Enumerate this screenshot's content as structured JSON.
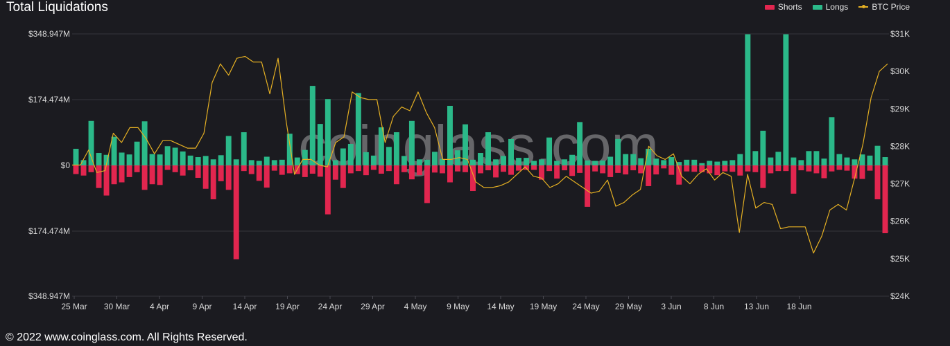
{
  "header": {
    "title": "Total Liquidations"
  },
  "legend": [
    {
      "label": "Shorts",
      "color": "#e2264f",
      "kind": "bar"
    },
    {
      "label": "Longs",
      "color": "#2bb989",
      "kind": "bar"
    },
    {
      "label": "BTC Price",
      "color": "#e5b023",
      "kind": "line"
    }
  ],
  "watermark": "coinglass.com",
  "footer": {
    "copyright": "© 2022 www.coinglass.com. All Rights Reserved."
  },
  "chart_data": {
    "type": "bar",
    "title": "Total Liquidations",
    "x_tick_labels": [
      "25 Mar",
      "30 Mar",
      "4 Apr",
      "9 Apr",
      "14 Apr",
      "19 Apr",
      "24 Apr",
      "29 Apr",
      "4 May",
      "9 May",
      "14 May",
      "19 May",
      "24 May",
      "29 May",
      "3 Jun",
      "8 Jun",
      "13 Jun",
      "18 Jun"
    ],
    "y_left_ticks": [
      "$348.947M",
      "$174.474M",
      "$0",
      "$174.474M",
      "$348.947M"
    ],
    "y_left_range": [
      -348.947,
      348.947
    ],
    "y_right_ticks": [
      "$31K",
      "$30K",
      "$29K",
      "$28K",
      "$27K",
      "$26K",
      "$25K",
      "$24K"
    ],
    "y_right_range": [
      24000,
      31000
    ],
    "units_left": "$M",
    "series": [
      {
        "name": "Longs",
        "color": "#2bb989",
        "values": [
          44,
          14,
          118,
          33,
          28,
          76,
          34,
          29,
          63,
          117,
          30,
          29,
          51,
          47,
          37,
          26,
          22,
          25,
          16,
          27,
          78,
          16,
          88,
          14,
          12,
          23,
          14,
          15,
          84,
          21,
          41,
          211,
          110,
          176,
          14,
          45,
          57,
          192,
          35,
          26,
          101,
          49,
          88,
          25,
          118,
          16,
          15,
          36,
          17,
          158,
          40,
          109,
          15,
          33,
          88,
          16,
          25,
          70,
          20,
          20,
          12,
          16,
          74,
          12,
          16,
          28,
          115,
          13,
          12,
          13,
          23,
          70,
          30,
          30,
          19,
          44,
          18,
          14,
          22,
          9,
          15,
          15,
          6,
          12,
          10,
          12,
          14,
          30,
          348,
          38,
          92,
          21,
          36,
          348,
          21,
          14,
          38,
          38,
          18,
          128,
          30,
          21,
          16,
          29,
          26,
          52,
          22
        ]
      },
      {
        "name": "Shorts",
        "color": "#e2264f",
        "values": [
          23,
          27,
          18,
          60,
          80,
          50,
          45,
          31,
          18,
          65,
          50,
          52,
          12,
          18,
          27,
          13,
          33,
          62,
          90,
          42,
          65,
          249,
          15,
          23,
          41,
          59,
          14,
          25,
          21,
          23,
          31,
          22,
          30,
          130,
          38,
          60,
          21,
          15,
          26,
          12,
          22,
          15,
          50,
          18,
          37,
          26,
          100,
          19,
          21,
          45,
          16,
          18,
          68,
          21,
          13,
          32,
          17,
          25,
          14,
          12,
          12,
          38,
          15,
          35,
          13,
          28,
          20,
          110,
          16,
          21,
          31,
          20,
          24,
          13,
          21,
          55,
          24,
          8,
          25,
          51,
          16,
          17,
          18,
          21,
          26,
          16,
          17,
          27,
          16,
          18,
          60,
          21,
          15,
          15,
          75,
          13,
          16,
          21,
          34,
          16,
          12,
          14,
          35,
          36,
          14,
          90,
          180
        ]
      },
      {
        "name": "BTC Price",
        "color": "#e5b023",
        "values": [
          27500,
          27500,
          27900,
          27300,
          27350,
          28350,
          28100,
          28500,
          28500,
          28200,
          27800,
          28150,
          28150,
          28050,
          27950,
          27950,
          28350,
          29700,
          30200,
          29900,
          30350,
          30400,
          30250,
          30250,
          29400,
          30350,
          28650,
          27250,
          27650,
          27650,
          27500,
          27450,
          28100,
          28250,
          29450,
          29300,
          29250,
          29250,
          28100,
          28800,
          29050,
          28950,
          29450,
          28900,
          28500,
          27650,
          27650,
          27700,
          27650,
          27050,
          26900,
          26900,
          26950,
          27050,
          27250,
          27450,
          27200,
          27150,
          26900,
          27000,
          27200,
          27050,
          26900,
          26750,
          26800,
          27100,
          26400,
          26500,
          26700,
          26850,
          28000,
          27750,
          27650,
          27800,
          27200,
          27000,
          27250,
          27400,
          27100,
          27300,
          27200,
          25700,
          27250,
          26350,
          26500,
          26450,
          25800,
          25850,
          25850,
          25850,
          25150,
          25600,
          26300,
          26450,
          26300,
          27150,
          28050,
          29300,
          30000,
          30200
        ]
      }
    ]
  }
}
